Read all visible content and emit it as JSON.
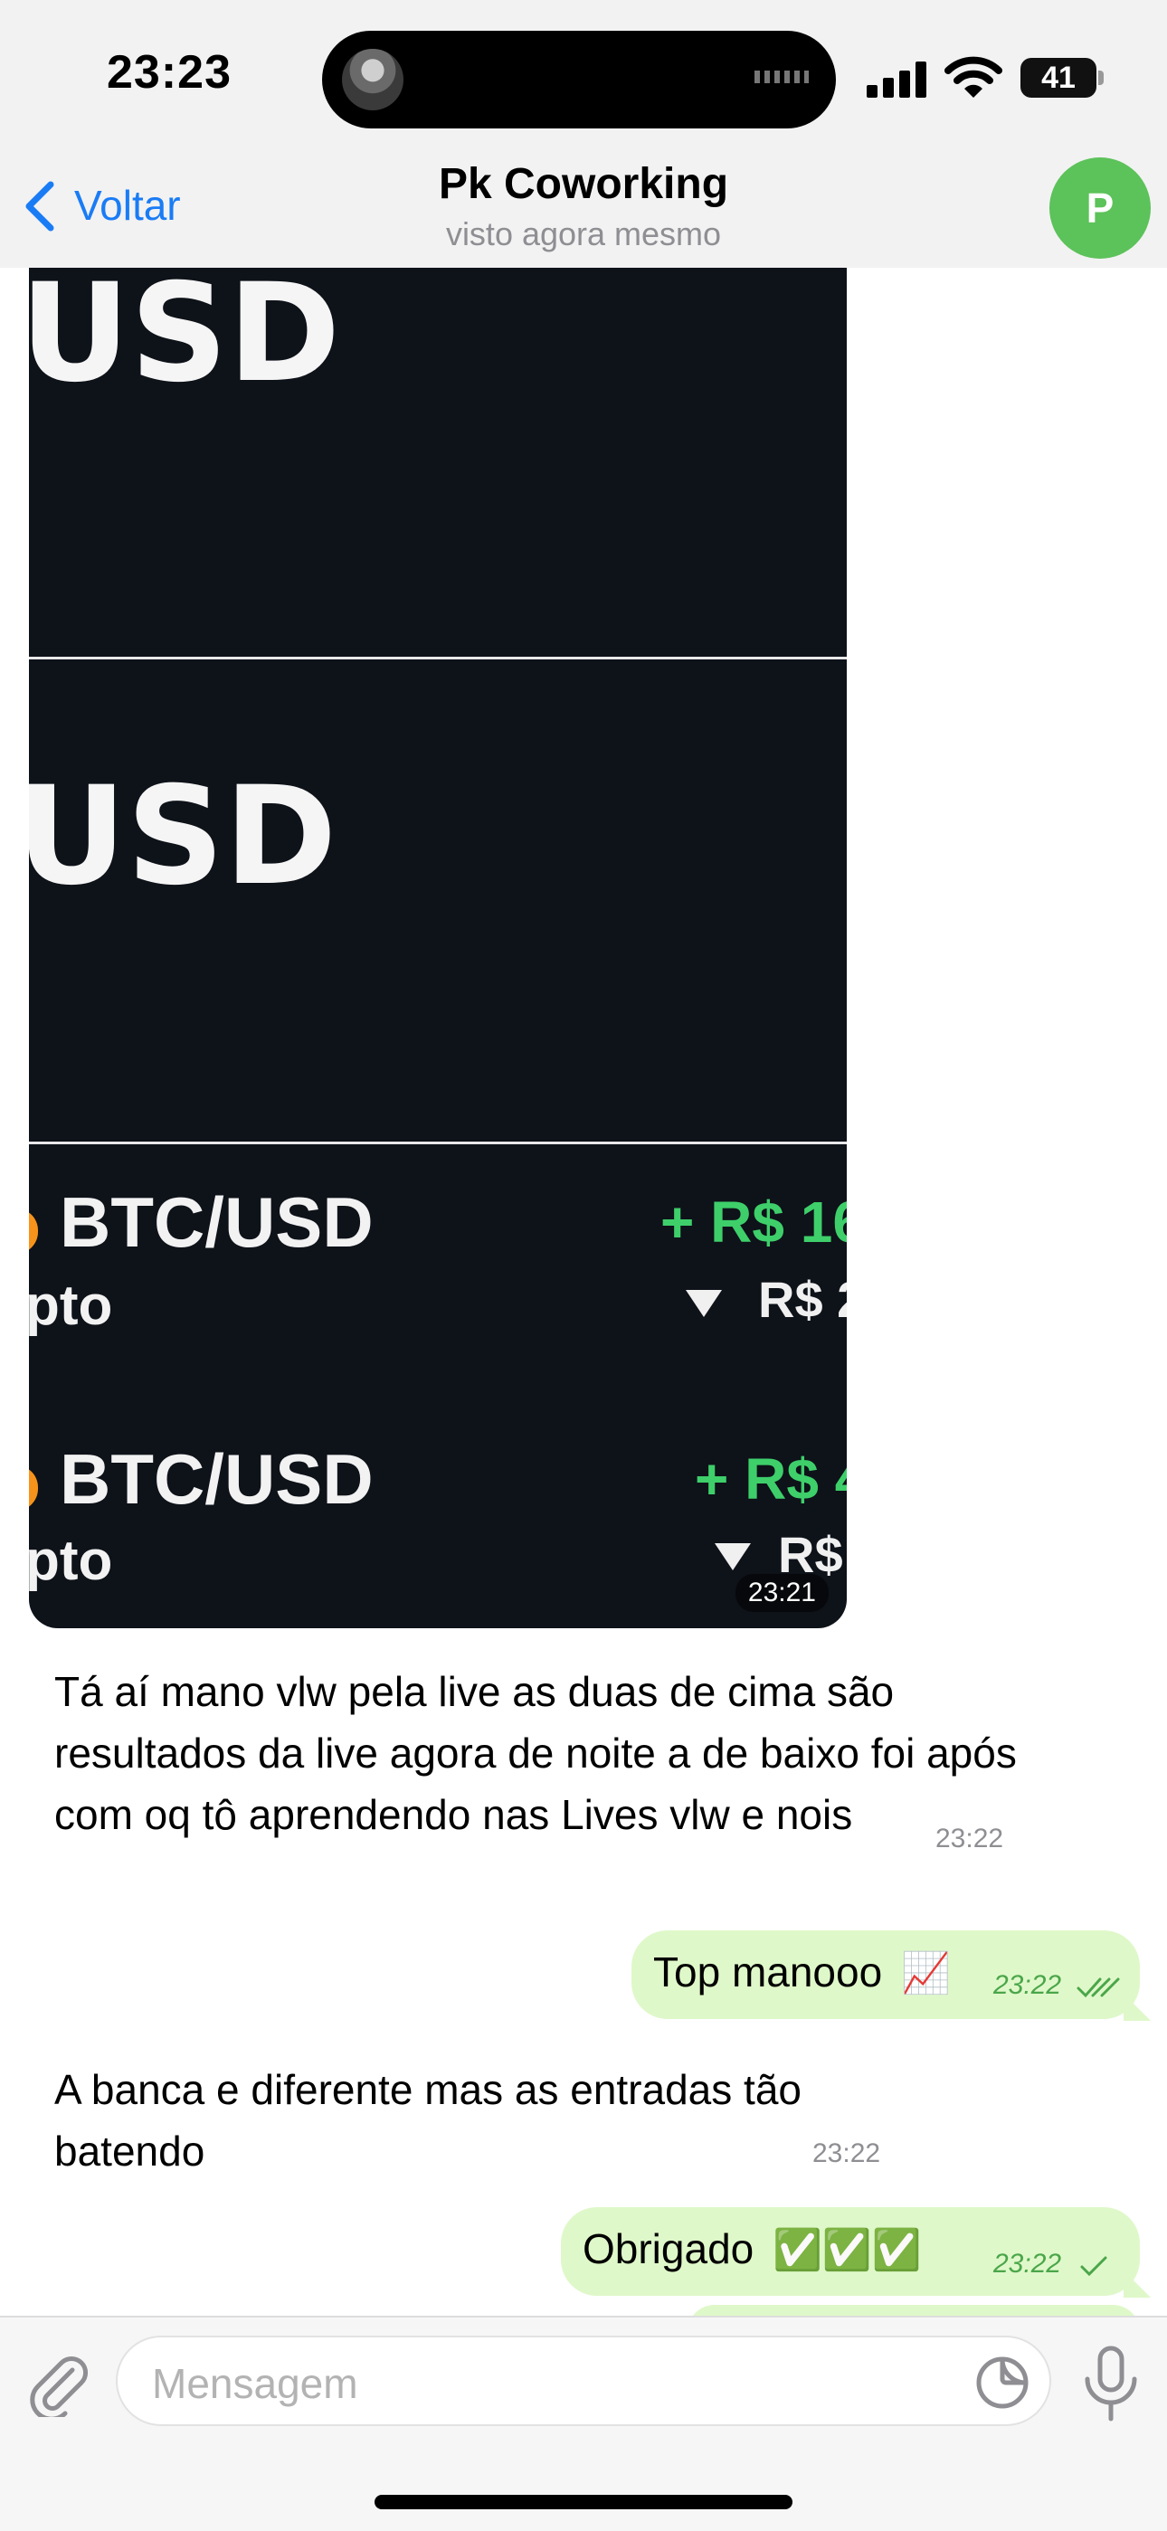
{
  "status_bar": {
    "time": "23:23",
    "battery": "41"
  },
  "nav": {
    "back_label": "Voltar",
    "title": "Pk Coworking",
    "subtitle": "visto agora mesmo",
    "avatar_letter": "P"
  },
  "photo": {
    "usd_top": "USD",
    "usd_mid": "USD",
    "rows": [
      {
        "pair": "BTC/USD",
        "type": "pto",
        "gain": "+ R$ 16",
        "loss": "R$ 2"
      },
      {
        "pair": "BTC/USD",
        "type": "pto",
        "gain": "+ R$ 4",
        "loss": "R$"
      }
    ],
    "time": "23:21"
  },
  "messages": [
    {
      "direction": "in",
      "text": "Tá aí mano vlw pela live as duas de cima são resultados da live agora de noite a de baixo foi após com oq tô aprendendo nas Lives vlw e nois",
      "time": "23:22"
    },
    {
      "direction": "out",
      "text": "Top manooo",
      "emoji": "📈",
      "time": "23:22",
      "status": "read"
    },
    {
      "direction": "in",
      "text": "A banca e diferente mas as entradas tão batendo",
      "time": "23:22"
    },
    {
      "direction": "out",
      "text": "Obrigado",
      "emoji": "✅✅✅",
      "time": "23:22",
      "status": "sent"
    }
  ],
  "composer": {
    "placeholder": "Mensagem"
  },
  "colors": {
    "accent": "#1a7cf5",
    "outgoing_bubble": "#dff8c9",
    "avatar": "#5cc25a"
  }
}
